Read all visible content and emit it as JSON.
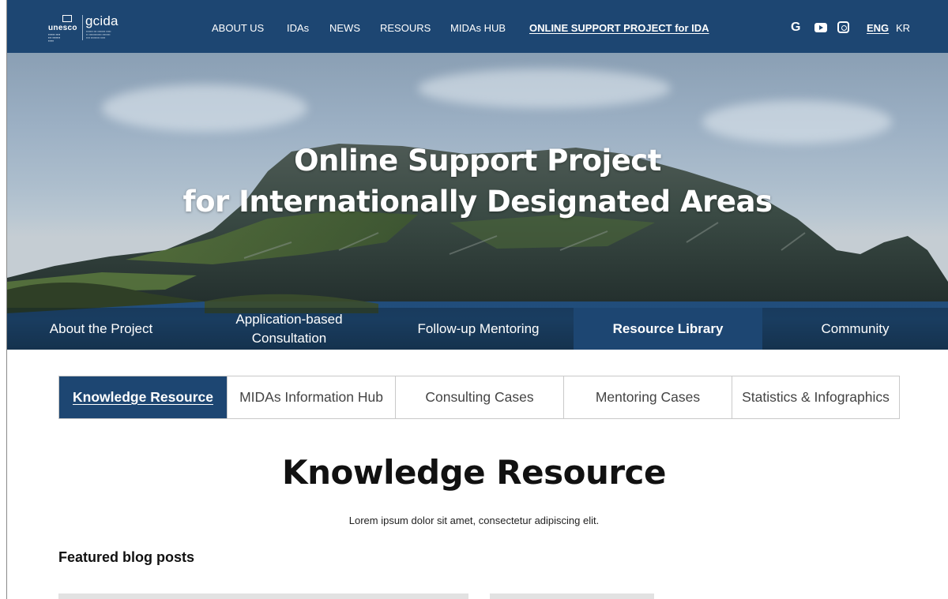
{
  "brand": {
    "unesco_word": "unesco",
    "gcida_word": "gcida"
  },
  "nav": {
    "items": [
      {
        "label": "ABOUT US",
        "active": false
      },
      {
        "label": "IDAs",
        "active": false
      },
      {
        "label": "NEWS",
        "active": false
      },
      {
        "label": "RESOURS",
        "active": false
      },
      {
        "label": "MIDAs HUB",
        "active": false
      },
      {
        "label": "ONLINE SUPPORT PROJECT for IDA",
        "active": true
      }
    ],
    "social": {
      "google": "G"
    },
    "languages": [
      {
        "label": "ENG",
        "active": true
      },
      {
        "label": "KR",
        "active": false
      }
    ]
  },
  "hero": {
    "title_line1": "Online Support Project",
    "title_line2": "for Internationally Designated Areas",
    "tabs": [
      {
        "label": "About the Project",
        "active": false
      },
      {
        "label": "Application-based Consultation",
        "active": false
      },
      {
        "label": "Follow-up Mentoring",
        "active": false
      },
      {
        "label": "Resource Library",
        "active": true
      },
      {
        "label": "Community",
        "active": false
      }
    ]
  },
  "subtabs": [
    {
      "label": "Knowledge Resource",
      "active": true
    },
    {
      "label": "MIDAs Information Hub",
      "active": false
    },
    {
      "label": "Consulting Cases",
      "active": false
    },
    {
      "label": "Mentoring Cases",
      "active": false
    },
    {
      "label": "Statistics & Infographics",
      "active": false
    }
  ],
  "content": {
    "title": "Knowledge Resource",
    "subtitle": "Lorem ipsum dolor sit amet, consectetur adipiscing elit.",
    "featured_label": "Featured blog posts"
  },
  "colors": {
    "primary": "#1d4672",
    "border": "#c9c9c9"
  }
}
